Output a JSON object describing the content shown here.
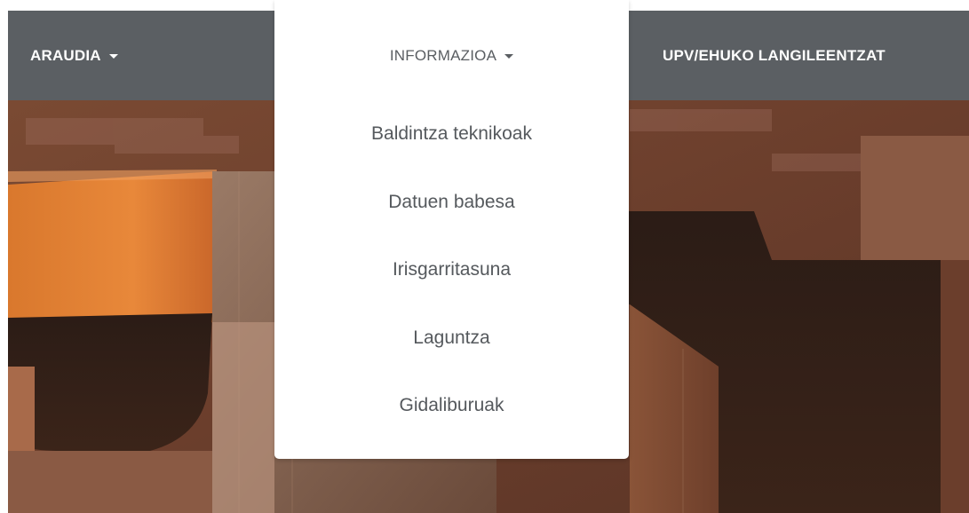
{
  "navbar": {
    "items": [
      {
        "label": "ARAUDIA"
      },
      {
        "label": "INFORMAZIOA"
      },
      {
        "label": "UPV/EHUKO LANGILEENTZAT"
      }
    ]
  },
  "dropdown": {
    "toggle_label": "INFORMAZIOA",
    "items": [
      {
        "label": "Baldintza teknikoak"
      },
      {
        "label": "Datuen babesa"
      },
      {
        "label": "Irisgarritasuna"
      },
      {
        "label": "Laguntza"
      },
      {
        "label": "Gidaliburuak"
      }
    ]
  },
  "colors": {
    "navbar_bg": "#5b5f63",
    "nav_text": "#ffffff",
    "dropdown_bg": "#ffffff",
    "dropdown_text": "#55595d"
  }
}
